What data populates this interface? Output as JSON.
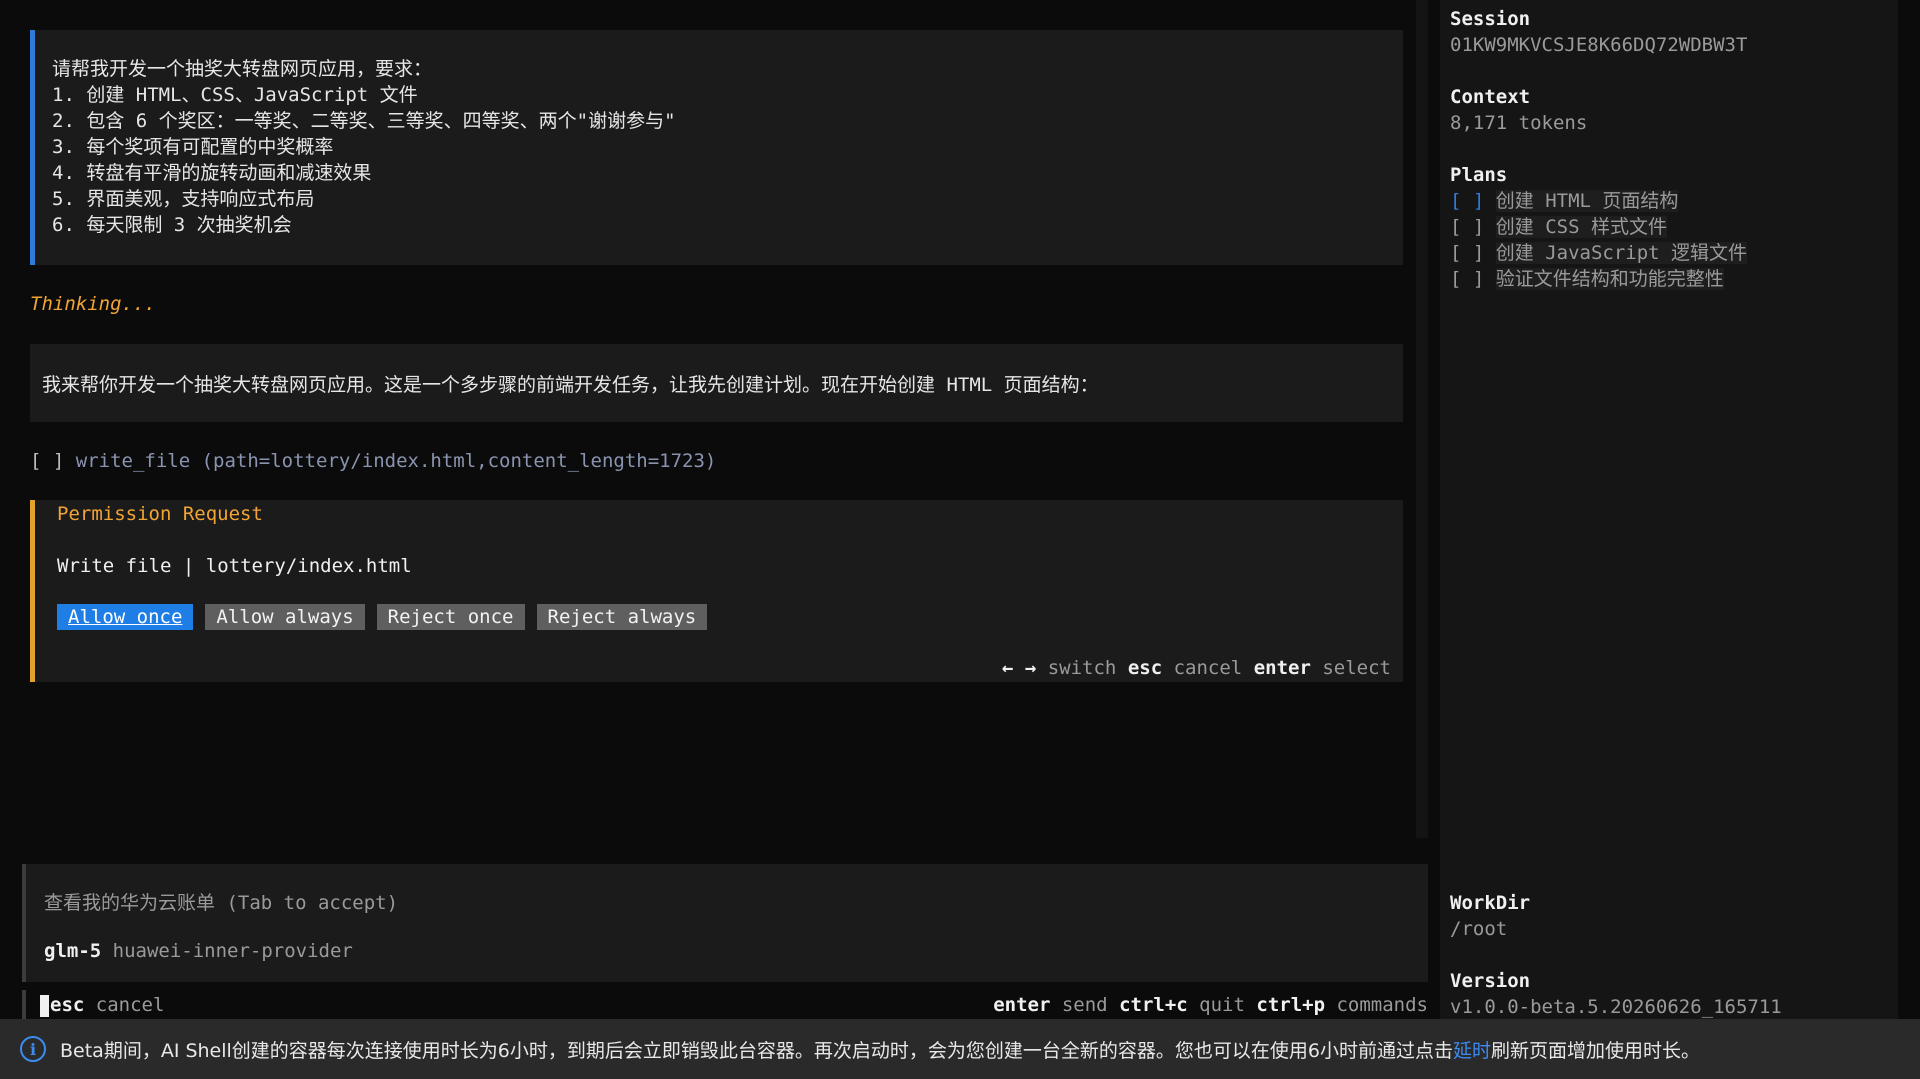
{
  "conversation": {
    "user_message_lines": [
      "请帮我开发一个抽奖大转盘网页应用，要求：",
      "1. 创建 HTML、CSS、JavaScript 文件",
      "2. 包含 6 个奖区：一等奖、二等奖、三等奖、四等奖、两个\"谢谢参与\"",
      "3. 每个奖项有可配置的中奖概率",
      "4. 转盘有平滑的旋转动画和减速效果",
      "5. 界面美观，支持响应式布局",
      "6. 每天限制 3 次抽奖机会"
    ],
    "thinking": "Thinking...",
    "assistant_message": "我来帮你开发一个抽奖大转盘网页应用。这是一个多步骤的前端开发任务，让我先创建计划。现在开始创建 HTML 页面结构：",
    "tool_call": {
      "checkbox": "[ ]",
      "text": "write_file (path=lottery/index.html,content_length=1723)"
    }
  },
  "permission": {
    "title": "Permission Request",
    "action": "Write file",
    "separator": "|",
    "path": "lottery/index.html",
    "buttons": [
      "Allow once",
      "Allow always",
      "Reject once",
      "Reject always"
    ],
    "hint": {
      "arrows": "← →",
      "switch": "switch",
      "esc": "esc",
      "cancel": "cancel",
      "enter": "enter",
      "select": "select"
    }
  },
  "input": {
    "suggestion": "查看我的华为云账单 (Tab to accept)",
    "model": "glm-5",
    "provider": "huawei-inner-provider"
  },
  "status": {
    "esc": "esc",
    "cancel": "cancel",
    "enter": "enter",
    "send": "send",
    "ctrlc": "ctrl+c",
    "quit": "quit",
    "ctrlp": "ctrl+p",
    "commands": "commands"
  },
  "sidebar": {
    "session_label": "Session",
    "session_value": "01KW9MKVCSJE8K66DQ72WDBW3T",
    "context_label": "Context",
    "context_value": "8,171 tokens",
    "plans_label": "Plans",
    "plans": [
      {
        "box": "[ ]",
        "text": "创建 HTML 页面结构"
      },
      {
        "box": "[ ]",
        "text": "创建 CSS 样式文件"
      },
      {
        "box": "[ ]",
        "text": "创建 JavaScript 逻辑文件"
      },
      {
        "box": "[ ]",
        "text": "验证文件结构和功能完整性"
      }
    ],
    "workdir_label": "WorkDir",
    "workdir_value": "/root",
    "version_label": "Version",
    "version_value": "v1.0.0-beta.5.20260626_165711"
  },
  "banner": {
    "text_before": "Beta期间，AI Shell创建的容器每次连接使用时长为6小时，到期后会立即销毁此台容器。再次启动时，会为您创建一台全新的容器。您也可以在使用6小时前通过点击",
    "link": "延时",
    "text_after": "刷新页面增加使用时长。"
  },
  "colors": {
    "accent_blue": "#1f7de6",
    "warning_orange": "#f2a534",
    "background": "#0b0b0b"
  }
}
